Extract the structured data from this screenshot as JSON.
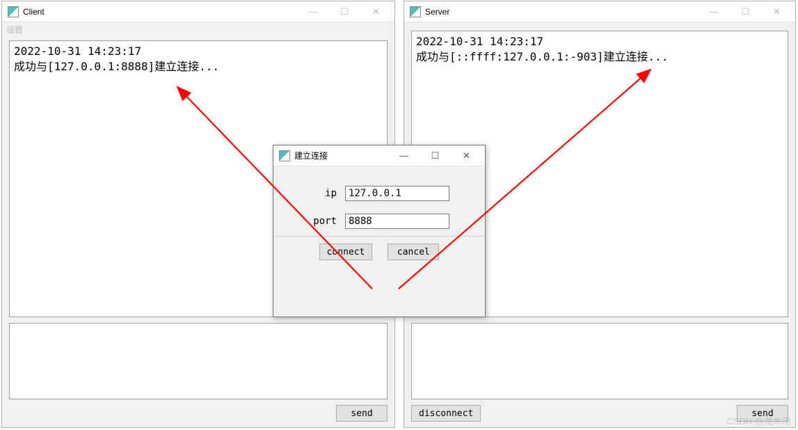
{
  "client": {
    "title": "Client",
    "menu_settings": "设置",
    "log_line1": "2022-10-31 14:23:17",
    "log_line2": "成功与[127.0.0.1:8888]建立连接...",
    "send_label": "send"
  },
  "server": {
    "title": "Server",
    "log_line1": "2022-10-31 14:23:17",
    "log_line2": "成功与[::ffff:127.0.0.1:-903]建立连接...",
    "disconnect_label": "disconnect",
    "send_label": "send"
  },
  "dialog": {
    "title": "建立连接",
    "ip_label": "ip",
    "ip_value": "127.0.0.1",
    "port_label": "port",
    "port_value": "8888",
    "connect_label": "connect",
    "cancel_label": "cancel"
  },
  "window_controls": {
    "min": "—",
    "max": "☐",
    "close": "✕"
  },
  "watermark": "CSDN @龙木南"
}
